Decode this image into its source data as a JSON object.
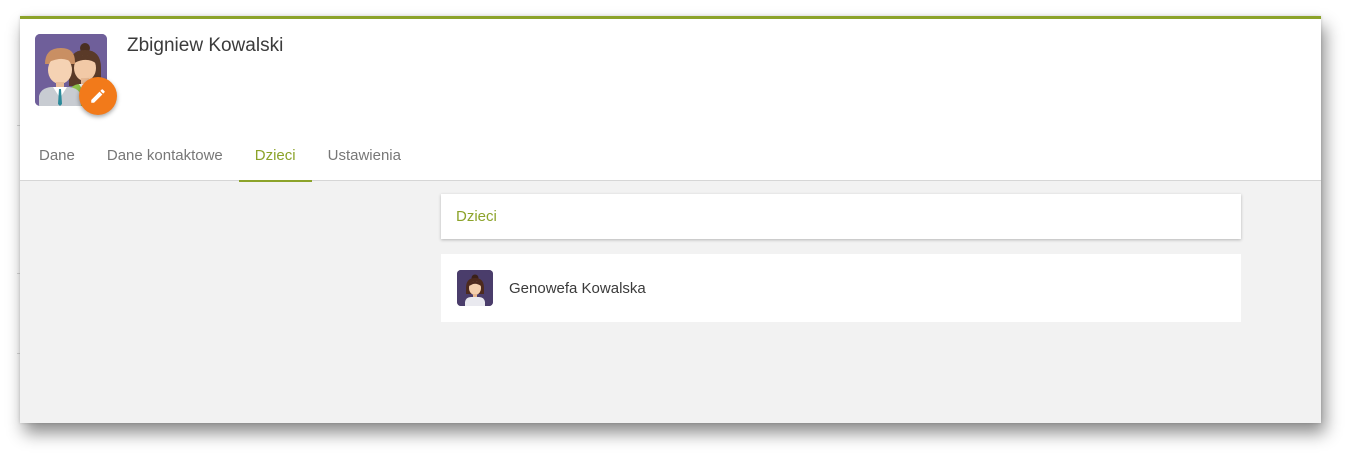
{
  "profile": {
    "name": "Zbigniew Kowalski",
    "avatar_icon": "parents-avatar-icon",
    "edit_icon": "pencil-icon"
  },
  "tabs": [
    {
      "label": "Dane",
      "active": false
    },
    {
      "label": "Dane kontaktowe",
      "active": false
    },
    {
      "label": "Dzieci",
      "active": true
    },
    {
      "label": "Ustawienia",
      "active": false
    }
  ],
  "section": {
    "title": "Dzieci"
  },
  "children": [
    {
      "name": "Genowefa Kowalska",
      "avatar_icon": "girl-avatar-icon"
    }
  ],
  "colors": {
    "accent": "#8ca32a",
    "edit_button": "#f27a1a",
    "avatar_bg": "#6f5f9a"
  }
}
